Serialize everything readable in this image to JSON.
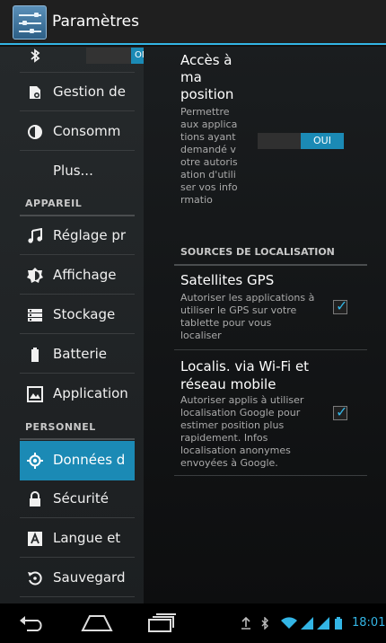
{
  "actionbar": {
    "title": "Paramètres",
    "icon": "settings-icon"
  },
  "sidebar": {
    "items": [
      {
        "label": "",
        "icon": "bluetooth-icon",
        "toggle": "ON"
      },
      {
        "label": "Gestion de",
        "icon": "app-manage-icon"
      },
      {
        "label": "Consomm",
        "icon": "data-usage-icon"
      },
      {
        "label": "Plus...",
        "icon": ""
      }
    ],
    "section_device": "APPAREIL",
    "device_items": [
      {
        "label": "Réglage pr",
        "icon": "sound-icon"
      },
      {
        "label": "Affichage",
        "icon": "brightness-icon"
      },
      {
        "label": "Stockage",
        "icon": "storage-icon"
      },
      {
        "label": "Batterie",
        "icon": "battery-icon"
      },
      {
        "label": "Application",
        "icon": "apps-icon"
      }
    ],
    "section_personal": "PERSONNEL",
    "personal_items": [
      {
        "label": "Données d",
        "icon": "location-icon",
        "active": true
      },
      {
        "label": "Sécurité",
        "icon": "lock-icon"
      },
      {
        "label": "Langue et",
        "icon": "language-icon"
      },
      {
        "label": "Sauvegard",
        "icon": "backup-icon"
      }
    ]
  },
  "main": {
    "access_title": "Accès à ma position",
    "access_desc": "Permettre aux applications ayant demandé votre autorisation d'utiliser vos informatio",
    "access_toggle": "OUI",
    "sources_header": "SOURCES DE LOCALISATION",
    "gps_title": "Satellites GPS",
    "gps_desc": "Autoriser les applications à utiliser le GPS sur votre tablette pour vous localiser",
    "gps_checked": true,
    "wifi_title": "Localis. via Wi-Fi et réseau mobile",
    "wifi_desc": "Autoriser applis à utiliser localisation Google pour estimer position plus rapidement. Infos localisation anonymes envoyées à Google.",
    "wifi_checked": true
  },
  "statusbar": {
    "time": "18:01"
  },
  "colors": {
    "accent": "#33b5e5",
    "selected": "#1b8ab5"
  }
}
